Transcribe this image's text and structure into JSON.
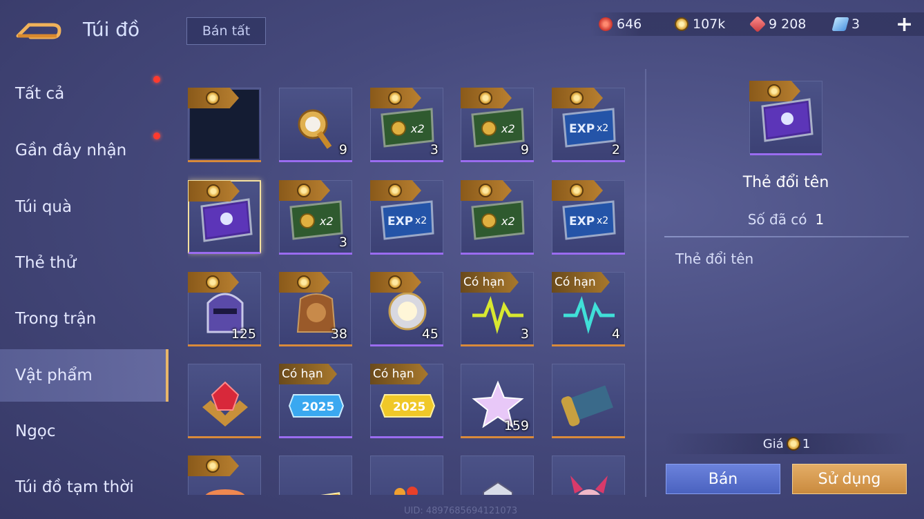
{
  "header": {
    "title": "Túi đồ",
    "sell_all_label": "Bán tất",
    "currencies": [
      {
        "icon": "ruby-icon",
        "value": "646",
        "color": "#e2443c"
      },
      {
        "icon": "gold-coin-icon",
        "value": "107k",
        "color": "#e8c266"
      },
      {
        "icon": "red-gem-icon",
        "value": "9 208",
        "color": "#e6585a"
      },
      {
        "icon": "blue-ticket-icon",
        "value": "3",
        "color": "#6fb6f0"
      }
    ],
    "plus_label": "+"
  },
  "sidebar": {
    "items": [
      {
        "label": "Tất cả",
        "badge": true
      },
      {
        "label": "Gần đây nhận",
        "badge": true
      },
      {
        "label": "Túi quà",
        "badge": false
      },
      {
        "label": "Thẻ thử",
        "badge": false
      },
      {
        "label": "Trong trận",
        "badge": false
      },
      {
        "label": "Vật phẩm",
        "badge": false,
        "active": true
      },
      {
        "label": "Ngọc",
        "badge": false
      },
      {
        "label": "Túi đồ tạm thời",
        "badge": false
      }
    ]
  },
  "grid": {
    "limited_label": "Có hạn",
    "items": [
      {
        "icon": "empty-item-icon",
        "tag": "coin",
        "count": "",
        "rarity": "orange"
      },
      {
        "icon": "golden-trophy-icon",
        "tag": "",
        "count": "9",
        "rarity": "purple"
      },
      {
        "icon": "gold-x2-card-icon",
        "tag": "coin",
        "count": "3",
        "rarity": "purple"
      },
      {
        "icon": "gold-x2-card-icon",
        "tag": "coin",
        "count": "9",
        "rarity": "purple"
      },
      {
        "icon": "exp-x2-card-icon",
        "tag": "coin",
        "count": "2",
        "rarity": "purple"
      },
      {
        "icon": "rename-card-icon",
        "tag": "coin",
        "count": "",
        "rarity": "purple",
        "selected": true
      },
      {
        "icon": "gold-x2-card-icon",
        "tag": "coin",
        "count": "3",
        "rarity": "purple"
      },
      {
        "icon": "exp-x2-card-icon",
        "tag": "coin",
        "count": "",
        "rarity": "purple"
      },
      {
        "icon": "gold-x2-card-icon",
        "tag": "coin",
        "count": "",
        "rarity": "purple"
      },
      {
        "icon": "exp-x2-card-icon",
        "tag": "coin",
        "count": "",
        "rarity": "purple"
      },
      {
        "icon": "helmet-icon",
        "tag": "coin",
        "count": "125",
        "rarity": "orange"
      },
      {
        "icon": "rock-armor-icon",
        "tag": "coin",
        "count": "38",
        "rarity": "orange"
      },
      {
        "icon": "orb-icon",
        "tag": "coin",
        "count": "45",
        "rarity": "purple"
      },
      {
        "icon": "heartbeat-yellow-icon",
        "tag": "limited",
        "count": "3",
        "rarity": "orange"
      },
      {
        "icon": "heartbeat-cyan-icon",
        "tag": "limited",
        "count": "4",
        "rarity": "orange"
      },
      {
        "icon": "red-gem-emblem-icon",
        "tag": "",
        "count": "",
        "rarity": "orange"
      },
      {
        "icon": "badge-2025-blue-icon",
        "tag": "limited",
        "count": "",
        "rarity": "purple"
      },
      {
        "icon": "badge-2025-gold-icon",
        "tag": "limited",
        "count": "",
        "rarity": "purple"
      },
      {
        "icon": "star-crystal-icon",
        "tag": "",
        "count": "159",
        "rarity": "orange"
      },
      {
        "icon": "scroll-icon",
        "tag": "",
        "count": "",
        "rarity": "orange"
      },
      {
        "icon": "sushi-icon",
        "tag": "coin",
        "count": "",
        "rarity": "orange"
      },
      {
        "icon": "anniversary-ticket-icon",
        "tag": "",
        "count": "",
        "rarity": "orange"
      },
      {
        "icon": "fruit-cup-icon",
        "tag": "",
        "count": "",
        "rarity": "orange"
      },
      {
        "icon": "armor-suit-icon",
        "tag": "",
        "count": "",
        "rarity": "orange"
      },
      {
        "icon": "pink-creature-icon",
        "tag": "",
        "count": "",
        "rarity": "orange"
      }
    ]
  },
  "detail": {
    "icon": "rename-card-icon",
    "name": "Thẻ đổi tên",
    "owned_label": "Số đã có",
    "owned_value": "1",
    "description": "Thẻ đổi tên",
    "price_label": "Giá",
    "price_value": "1",
    "sell_label": "Bán",
    "use_label": "Sử dụng"
  },
  "footer": {
    "uid": "UID: 4897685694121073"
  },
  "colors": {
    "rarity_orange": "#d98a3a",
    "rarity_purple": "#9a6cf0",
    "accent_gold": "#e8b66a"
  }
}
